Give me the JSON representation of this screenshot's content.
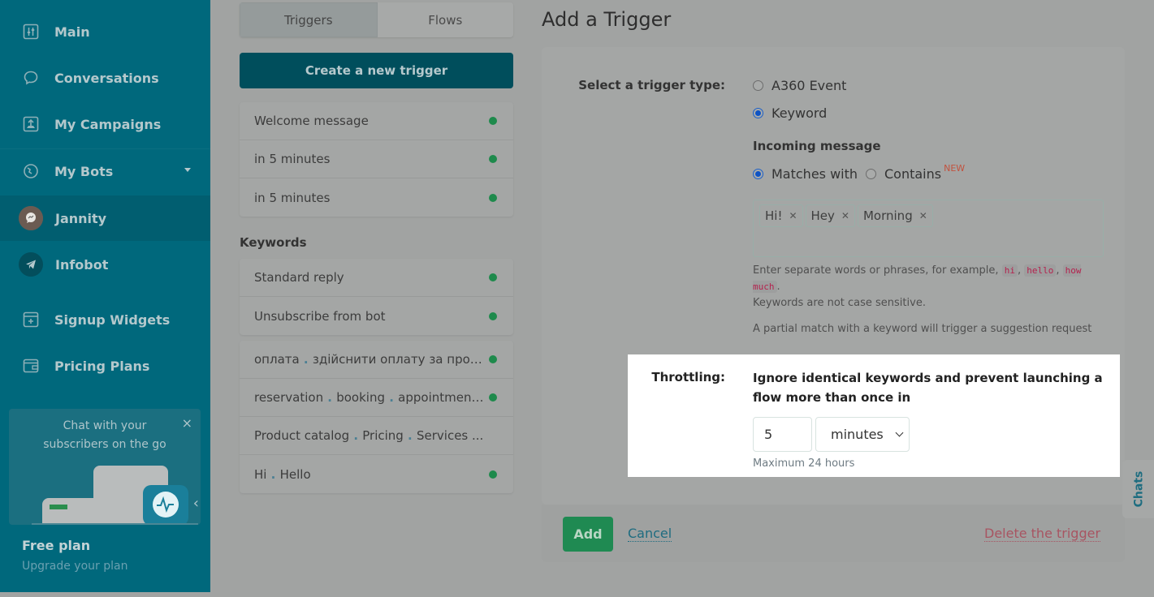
{
  "sidebar": {
    "items": [
      {
        "label": "Main",
        "icon": "sliders-icon"
      },
      {
        "label": "Conversations",
        "icon": "chat-bubble-icon"
      },
      {
        "label": "My Campaigns",
        "icon": "campaign-upload-icon"
      },
      {
        "label": "My Bots",
        "icon": "bots-icon"
      },
      {
        "label": "Jannity",
        "icon": "messenger-avatar-icon"
      },
      {
        "label": "Infobot",
        "icon": "telegram-icon"
      },
      {
        "label": "Signup Widgets",
        "icon": "widget-icon"
      },
      {
        "label": "Pricing Plans",
        "icon": "wallet-icon"
      }
    ],
    "promo": {
      "text": "Chat with your subscribers on the go",
      "close": "×",
      "arrow": "‹"
    },
    "plan": {
      "title": "Free plan",
      "link": "Upgrade your plan"
    }
  },
  "middle": {
    "tabs": [
      {
        "label": "Triggers",
        "active": true
      },
      {
        "label": "Flows",
        "active": false
      }
    ],
    "create_button": "Create a new trigger",
    "event_triggers": [
      {
        "label": "Welcome message",
        "active": true
      },
      {
        "label": "in 5 minutes",
        "active": true
      },
      {
        "label": "in 5 minutes",
        "active": true
      }
    ],
    "keywords_label": "Keywords",
    "keyword_defaults": [
      {
        "label": "Standard reply",
        "active": true
      },
      {
        "label": "Unsubscribe from bot",
        "active": true
      }
    ],
    "keyword_triggers": [
      {
        "parts": [
          "оплата",
          "здійснити оплату за прод..."
        ],
        "active": true
      },
      {
        "parts": [
          "reservation",
          "booking",
          "appointment..."
        ],
        "active": true
      },
      {
        "parts": [
          "Product catalog",
          "Pricing",
          "Services ..."
        ],
        "active": false
      },
      {
        "parts": [
          "Hi",
          "Hello"
        ],
        "active": true
      }
    ],
    "separator": "."
  },
  "main": {
    "title": "Add a Trigger",
    "trigger_type_label": "Select a trigger type:",
    "trigger_types": [
      {
        "label": "A360 Event",
        "checked": false
      },
      {
        "label": "Keyword",
        "checked": true
      }
    ],
    "incoming_heading": "Incoming message",
    "match_modes": [
      {
        "label": "Matches with",
        "checked": true
      },
      {
        "label": "Contains",
        "checked": false,
        "badge": "NEW"
      }
    ],
    "tags": [
      "Hi!",
      "Hey",
      "Morning"
    ],
    "hint_prefix": "Enter separate words or phrases, for example,",
    "hint_examples": [
      "hi",
      "hello",
      "how much"
    ],
    "hint_case": "Keywords are not case sensitive.",
    "hint_partial": "A partial match with a keyword will trigger a suggestion request",
    "throttling": {
      "label": "Throttling:",
      "text": "Ignore identical keywords and prevent launching a flow more than once in",
      "value": "5",
      "unit": "minutes",
      "hint": "Maximum 24 hours"
    },
    "add_button": "Add",
    "cancel_link": "Cancel",
    "delete_link": "Delete the trigger"
  },
  "chats_tab": "Chats",
  "colors": {
    "sidebar": "#00687c",
    "primary_button": "#004e5c",
    "add_button": "#1f8a52",
    "status_dot": "#1e8a4c",
    "radio_checked": "#0e53c4",
    "new_badge": "#c2523e",
    "delete_link": "#a85562"
  }
}
